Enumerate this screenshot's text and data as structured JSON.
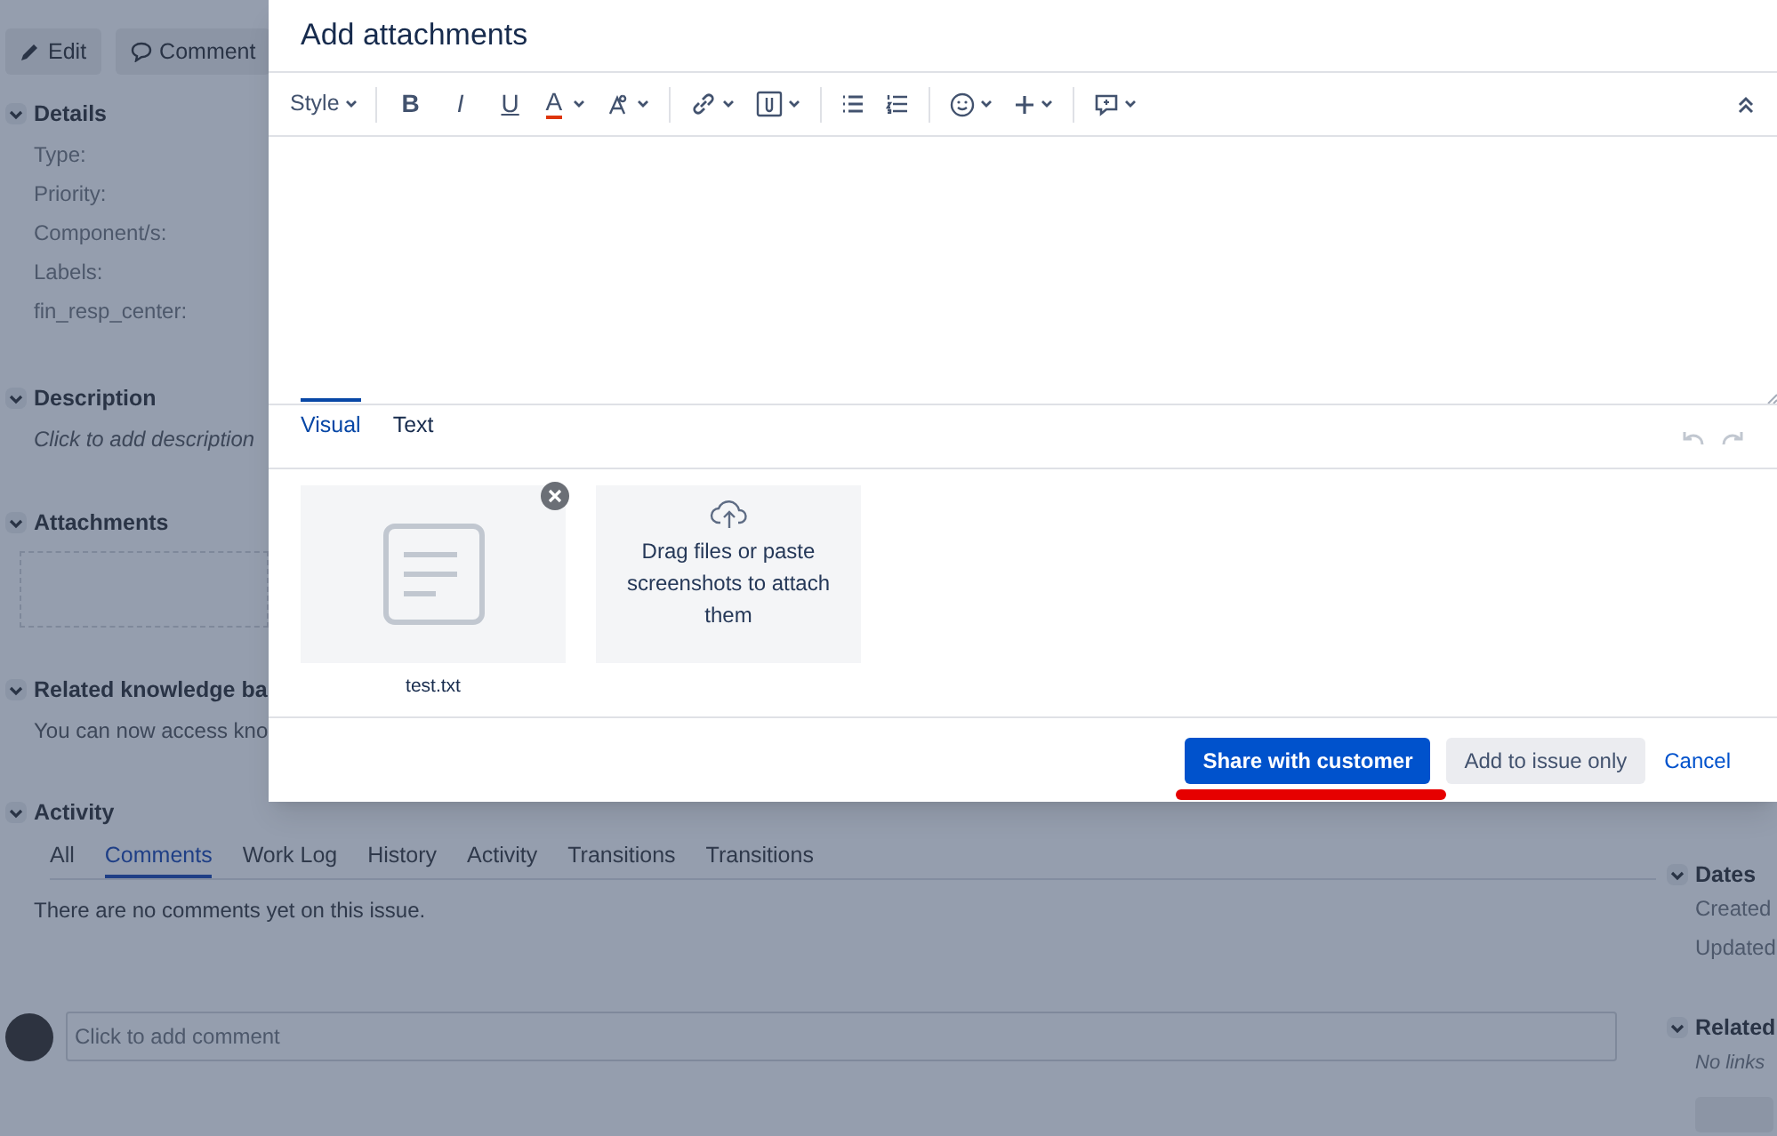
{
  "issue": {
    "actions": [
      {
        "kind": "edit",
        "label": "Edit"
      },
      {
        "kind": "comment",
        "label": "Comment"
      }
    ],
    "details": {
      "title": "Details",
      "expanded": true,
      "fields": [
        "Type:",
        "Priority:",
        "Component/s:",
        "Labels:",
        "fin_resp_center:"
      ]
    },
    "description": {
      "title": "Description",
      "expanded": true,
      "placeholder": "Click to add description"
    },
    "attachments": {
      "title": "Attachments",
      "expanded": true
    },
    "knowledge": {
      "title": "Related knowledge ba",
      "expanded": true,
      "text": "You can now access kno"
    },
    "activity": {
      "title": "Activity",
      "expanded": true,
      "tabs": [
        {
          "label": "All",
          "selected": false
        },
        {
          "label": "Comments",
          "selected": true
        },
        {
          "label": "Work Log",
          "selected": false
        },
        {
          "label": "History",
          "selected": false
        },
        {
          "label": "Activity",
          "selected": false
        },
        {
          "label": "Transitions",
          "selected": false
        },
        {
          "label": "Transitions",
          "selected": false
        }
      ],
      "empty_message": "There are no comments yet on this issue.",
      "comment_placeholder": "Click to add comment"
    },
    "sidebar": {
      "dates": {
        "title": "Dates",
        "expanded": true,
        "fields": [
          "Created",
          "Updated"
        ]
      },
      "related": {
        "title": "Related",
        "expanded": true,
        "text": "No links"
      }
    }
  },
  "dialog": {
    "title": "Add attachments",
    "toolbar": {
      "style_label": "Style",
      "format_keys": [
        "B",
        "I",
        "U"
      ],
      "color_key": "A"
    },
    "tabs": [
      {
        "label": "Visual",
        "selected": true
      },
      {
        "label": "Text",
        "selected": false
      }
    ],
    "files": [
      {
        "name": "test.txt"
      }
    ],
    "drop_hint": "Drag files or paste screenshots to attach them",
    "buttons": [
      {
        "kind": "primary",
        "label": "Share with customer",
        "underlined": true
      },
      {
        "kind": "secondary",
        "label": "Add to issue only",
        "underlined": false
      },
      {
        "kind": "link",
        "label": "Cancel",
        "underlined": false
      }
    ]
  }
}
